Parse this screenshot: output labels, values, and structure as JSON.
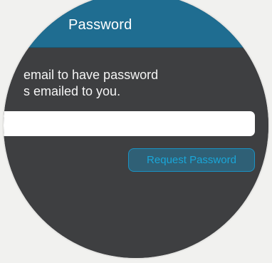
{
  "navbar": {
    "title": "Password"
  },
  "instructions": {
    "line1": "email to have password",
    "line2": "s emailed to you."
  },
  "email_field": {
    "value": "",
    "placeholder": ""
  },
  "request_button": {
    "label": "Request Password"
  },
  "colors": {
    "navbar": "#1f6d91",
    "background": "#3e3f41",
    "accent": "#1aa6d8",
    "page": "#f1f1ef"
  }
}
